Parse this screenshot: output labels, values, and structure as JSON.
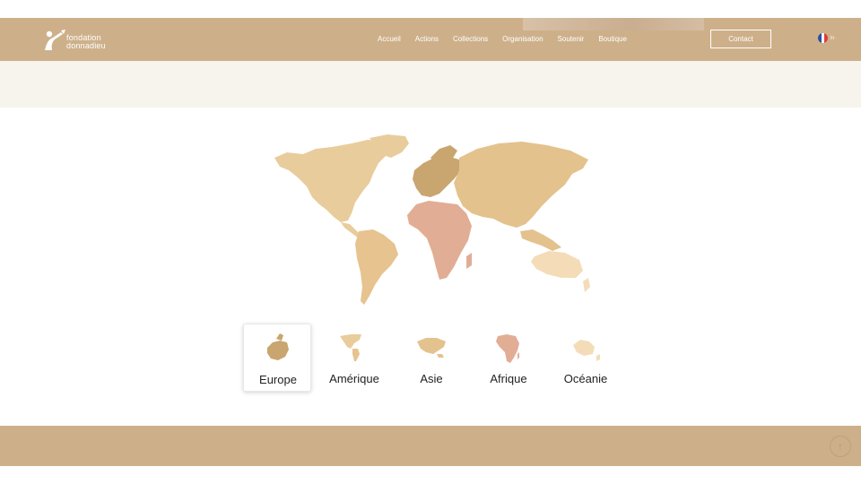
{
  "header": {
    "logo_line1": "fondation",
    "logo_line2": "donnadieu",
    "nav": [
      "Accueil",
      "Actions",
      "Collections",
      "Organisation",
      "Soutenir",
      "Boutique"
    ],
    "contact_label": "Contact",
    "lang_label": "Fr"
  },
  "regions": [
    {
      "label": "Europe",
      "active": true
    },
    {
      "label": "Amérique",
      "active": false
    },
    {
      "label": "Asie",
      "active": false
    },
    {
      "label": "Afrique",
      "active": false
    },
    {
      "label": "Océanie",
      "active": false
    }
  ],
  "colors": {
    "header_bg": "#cdb08a",
    "band_bg": "#f7f4ee",
    "europe": "#c9a56f",
    "america": "#e9cc9c",
    "asia": "#e4c28d",
    "africa": "#e2ad95",
    "oceania": "#f4dcb8"
  },
  "icons": {
    "logo": "donnadieu-logo-icon",
    "scroll_top": "arrow-up-icon",
    "flag": "france-flag-icon"
  }
}
